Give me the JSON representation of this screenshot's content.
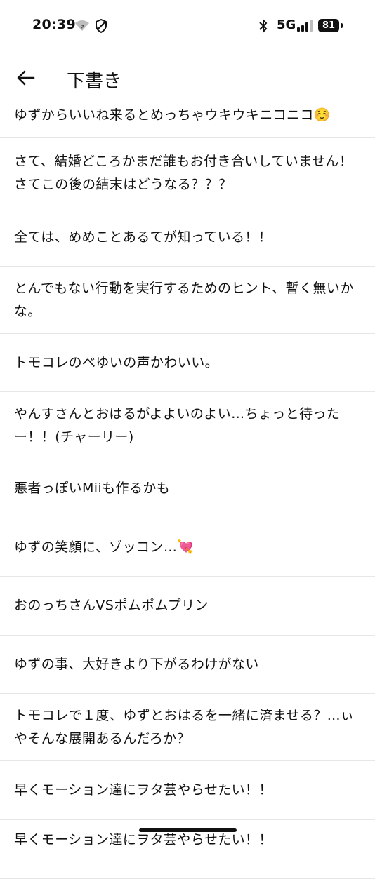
{
  "status_bar": {
    "time": "20:39",
    "network": "5G",
    "battery": "81",
    "icons": [
      "wifi-icon",
      "shield-icon",
      "bluetooth-icon",
      "signal-icon",
      "battery-icon"
    ]
  },
  "header": {
    "back_icon": "arrow-left-icon",
    "title": "下書き"
  },
  "drafts": [
    "ゆずからいいね来るとめっちゃウキウキニコニコ☺️",
    "さて、結婚どころかまだ誰もお付き合いしていません！さてこの後の結末はどうなる？？？",
    "全ては、めめことあるてが知っている！！",
    "とんでもない行動を実行するためのヒント、暫く無いかな。",
    "トモコレのべゆいの声かわいい。",
    "やんすさんとおはるがよよいのよい…ちょっと待ったー！！(チャーリー)",
    "悪者っぽいMiiも作るかも",
    "ゆずの笑顔に、ゾッコン…💘",
    "おのっちさんVSポムポムプリン",
    "ゆずの事、大好きより下がるわけがない",
    "トモコレで１度、ゆずとおはるを一緒に済ませる？…ぃやそんな展開あるんだろか？",
    "早くモーション達にヲタ芸やらせたい！！",
    "早くモーション達にヲタ芸やらせたい！！"
  ],
  "colors": {
    "background": "#ffffff",
    "text": "#111111",
    "divider": "#e6e6e6"
  }
}
